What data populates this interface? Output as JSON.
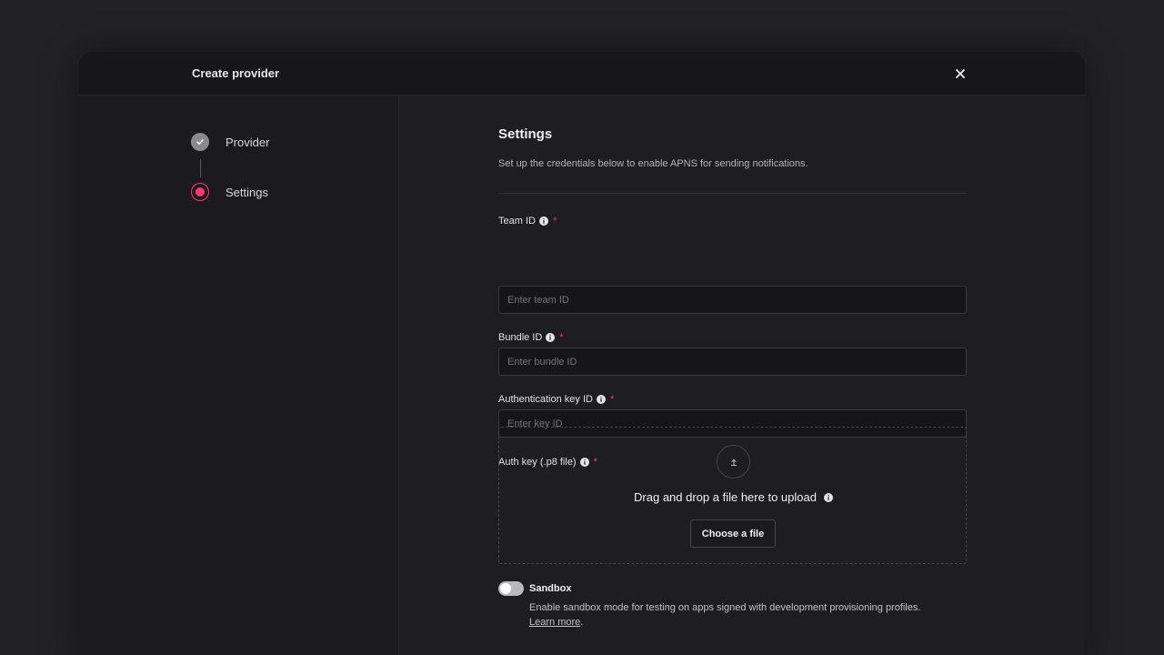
{
  "header": {
    "title": "Create provider",
    "close_icon": "close-icon"
  },
  "steps": [
    {
      "label": "Provider",
      "state": "completed",
      "icon": "check-icon"
    },
    {
      "label": "Settings",
      "state": "active"
    }
  ],
  "settings": {
    "title": "Settings",
    "description": "Set up the credentials below to enable APNS for sending notifications."
  },
  "fields": {
    "team_id": {
      "label": "Team ID",
      "required": "*",
      "placeholder": "Enter team ID",
      "value": ""
    },
    "bundle_id": {
      "label": "Bundle ID",
      "required": "*",
      "placeholder": "Enter bundle ID",
      "value": ""
    },
    "auth_key_id": {
      "label": "Authentication key ID",
      "required": "*",
      "placeholder": "Enter key ID",
      "value": ""
    },
    "auth_key_file": {
      "label": "Auth key (.p8 file)",
      "required": "*"
    }
  },
  "dropzone": {
    "title": "Drag and drop a file here to upload",
    "button_label": "Choose a file",
    "icon": "upload-icon"
  },
  "sandbox": {
    "label": "Sandbox",
    "enabled": false,
    "description": "Enable sandbox mode for testing on apps signed with development provisioning profiles.",
    "link_label": "Learn more",
    "link_suffix": "."
  },
  "colors": {
    "accent": "#fd366e",
    "background": "#222225",
    "panel": "#1e1e21"
  }
}
